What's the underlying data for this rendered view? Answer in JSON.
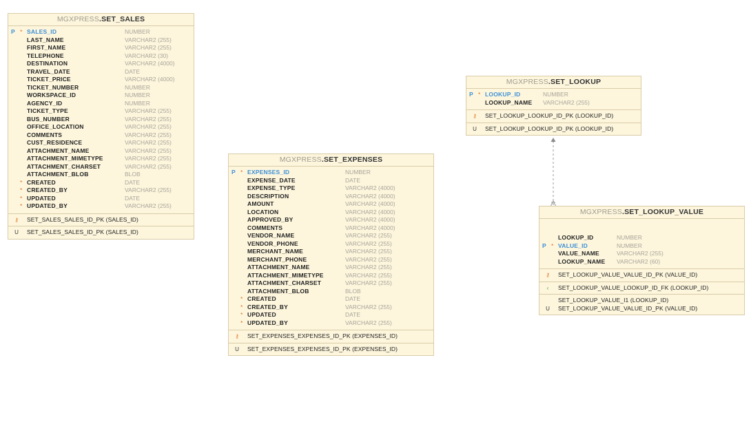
{
  "tables": [
    {
      "id": "set_sales",
      "schema": "MGXPRESS",
      "name": ".SET_SALES",
      "columns": [
        {
          "key": "P",
          "req": "*",
          "name": "SALES_ID",
          "type": "NUMBER",
          "pk": true
        },
        {
          "key": "",
          "req": "",
          "name": "LAST_NAME",
          "type": "VARCHAR2 (255)"
        },
        {
          "key": "",
          "req": "",
          "name": "FIRST_NAME",
          "type": "VARCHAR2 (255)"
        },
        {
          "key": "",
          "req": "",
          "name": "TELEPHONE",
          "type": "VARCHAR2 (30)"
        },
        {
          "key": "",
          "req": "",
          "name": "DESTINATION",
          "type": "VARCHAR2 (4000)"
        },
        {
          "key": "",
          "req": "",
          "name": "TRAVEL_DATE",
          "type": "DATE"
        },
        {
          "key": "",
          "req": "",
          "name": "TICKET_PRICE",
          "type": "VARCHAR2 (4000)"
        },
        {
          "key": "",
          "req": "",
          "name": "TICKET_NUMBER",
          "type": "NUMBER"
        },
        {
          "key": "",
          "req": "",
          "name": "WORKSPACE_ID",
          "type": "NUMBER"
        },
        {
          "key": "",
          "req": "",
          "name": "AGENCY_ID",
          "type": "NUMBER"
        },
        {
          "key": "",
          "req": "",
          "name": "TICKET_TYPE",
          "type": "VARCHAR2 (255)"
        },
        {
          "key": "",
          "req": "",
          "name": "BUS_NUMBER",
          "type": "VARCHAR2 (255)"
        },
        {
          "key": "",
          "req": "",
          "name": "OFFICE_LOCATION",
          "type": "VARCHAR2 (255)"
        },
        {
          "key": "",
          "req": "",
          "name": "COMMENTS",
          "type": "VARCHAR2 (255)"
        },
        {
          "key": "",
          "req": "",
          "name": "CUST_RESIDENCE",
          "type": "VARCHAR2 (255)"
        },
        {
          "key": "",
          "req": "",
          "name": "ATTACHMENT_NAME",
          "type": "VARCHAR2 (255)"
        },
        {
          "key": "",
          "req": "",
          "name": "ATTACHMENT_MIMETYPE",
          "type": "VARCHAR2 (255)"
        },
        {
          "key": "",
          "req": "",
          "name": "ATTACHMENT_CHARSET",
          "type": "VARCHAR2 (255)"
        },
        {
          "key": "",
          "req": "",
          "name": "ATTACHMENT_BLOB",
          "type": "BLOB"
        },
        {
          "key": "",
          "req": "*",
          "name": "CREATED",
          "type": "DATE"
        },
        {
          "key": "",
          "req": "*",
          "name": "CREATED_BY",
          "type": "VARCHAR2 (255)"
        },
        {
          "key": "",
          "req": "*",
          "name": "UPDATED",
          "type": "DATE"
        },
        {
          "key": "",
          "req": "*",
          "name": "UPDATED_BY",
          "type": "VARCHAR2 (255)"
        }
      ],
      "sections": [
        [
          {
            "sym": "key-icon",
            "text": "SET_SALES_SALES_ID_PK (SALES_ID)"
          }
        ],
        [
          {
            "sym": "U",
            "text": "SET_SALES_SALES_ID_PK (SALES_ID)"
          }
        ]
      ]
    },
    {
      "id": "set_expenses",
      "schema": "MGXPRESS",
      "name": ".SET_EXPENSES",
      "columns": [
        {
          "key": "P",
          "req": "*",
          "name": "EXPENSES_ID",
          "type": "NUMBER",
          "pk": true
        },
        {
          "key": "",
          "req": "",
          "name": "EXPENSE_DATE",
          "type": "DATE"
        },
        {
          "key": "",
          "req": "",
          "name": "EXPENSE_TYPE",
          "type": "VARCHAR2 (4000)"
        },
        {
          "key": "",
          "req": "",
          "name": "DESCRIPTION",
          "type": "VARCHAR2 (4000)"
        },
        {
          "key": "",
          "req": "",
          "name": "AMOUNT",
          "type": "VARCHAR2 (4000)"
        },
        {
          "key": "",
          "req": "",
          "name": "LOCATION",
          "type": "VARCHAR2 (4000)"
        },
        {
          "key": "",
          "req": "",
          "name": "APPROVED_BY",
          "type": "VARCHAR2 (4000)"
        },
        {
          "key": "",
          "req": "",
          "name": "COMMENTS",
          "type": "VARCHAR2 (4000)"
        },
        {
          "key": "",
          "req": "",
          "name": "VENDOR_NAME",
          "type": "VARCHAR2 (255)"
        },
        {
          "key": "",
          "req": "",
          "name": "VENDOR_PHONE",
          "type": "VARCHAR2 (255)"
        },
        {
          "key": "",
          "req": "",
          "name": "MERCHANT_NAME",
          "type": "VARCHAR2 (255)"
        },
        {
          "key": "",
          "req": "",
          "name": "MERCHANT_PHONE",
          "type": "VARCHAR2 (255)"
        },
        {
          "key": "",
          "req": "",
          "name": "ATTACHMENT_NAME",
          "type": "VARCHAR2 (255)"
        },
        {
          "key": "",
          "req": "",
          "name": "ATTACHMENT_MIMETYPE",
          "type": "VARCHAR2 (255)"
        },
        {
          "key": "",
          "req": "",
          "name": "ATTACHMENT_CHARSET",
          "type": "VARCHAR2 (255)"
        },
        {
          "key": "",
          "req": "",
          "name": "ATTACHMENT_BLOB",
          "type": "BLOB"
        },
        {
          "key": "",
          "req": "*",
          "name": "CREATED",
          "type": "DATE"
        },
        {
          "key": "",
          "req": "*",
          "name": "CREATED_BY",
          "type": "VARCHAR2 (255)"
        },
        {
          "key": "",
          "req": "*",
          "name": "UPDATED",
          "type": "DATE"
        },
        {
          "key": "",
          "req": "*",
          "name": "UPDATED_BY",
          "type": "VARCHAR2 (255)"
        }
      ],
      "sections": [
        [
          {
            "sym": "key-icon",
            "text": "SET_EXPENSES_EXPENSES_ID_PK (EXPENSES_ID)"
          }
        ],
        [
          {
            "sym": "U",
            "text": "SET_EXPENSES_EXPENSES_ID_PK (EXPENSES_ID)"
          }
        ]
      ]
    },
    {
      "id": "set_lookup",
      "schema": "MGXPRESS",
      "name": ".SET_LOOKUP",
      "columns": [
        {
          "key": "P",
          "req": "*",
          "name": "LOOKUP_ID",
          "type": "NUMBER",
          "pk": true
        },
        {
          "key": "",
          "req": "",
          "name": "LOOKUP_NAME",
          "type": "VARCHAR2 (255)"
        }
      ],
      "sections": [
        [
          {
            "sym": "key-icon",
            "text": "SET_LOOKUP_LOOKUP_ID_PK (LOOKUP_ID)"
          }
        ],
        [
          {
            "sym": "U",
            "text": "SET_LOOKUP_LOOKUP_ID_PK (LOOKUP_ID)"
          }
        ]
      ]
    },
    {
      "id": "set_lookup_value",
      "schema": "MGXPRESS",
      "name": ".SET_LOOKUP_VALUE",
      "columns": [
        {
          "key": "",
          "req": "",
          "name": "LOOKUP_ID",
          "type": "NUMBER"
        },
        {
          "key": "P",
          "req": "*",
          "name": "VALUE_ID",
          "type": "NUMBER",
          "pk": true
        },
        {
          "key": "",
          "req": "",
          "name": "VALUE_NAME",
          "type": "VARCHAR2 (255)"
        },
        {
          "key": "",
          "req": "",
          "name": "LOOKUP_NAME",
          "type": "VARCHAR2 (60)"
        }
      ],
      "sections": [
        [
          {
            "sym": "key-icon",
            "text": "SET_LOOKUP_VALUE_VALUE_ID_PK (VALUE_ID)"
          }
        ],
        [
          {
            "sym": "fk-icon",
            "text": "SET_LOOKUP_VALUE_LOOKUP_ID_FK (LOOKUP_ID)"
          }
        ],
        [
          {
            "sym": "",
            "text": "SET_LOOKUP_VALUE_I1 (LOOKUP_ID)"
          },
          {
            "sym": "U",
            "text": "SET_LOOKUP_VALUE_VALUE_ID_PK (VALUE_ID)"
          }
        ]
      ]
    }
  ],
  "colors": {
    "table_bg": "#fdf6dd",
    "table_border": "#d9cba6",
    "pk_blue": "#3d8fd6",
    "required_orange": "#e07020",
    "connector_gray": "#9a9a9a"
  }
}
